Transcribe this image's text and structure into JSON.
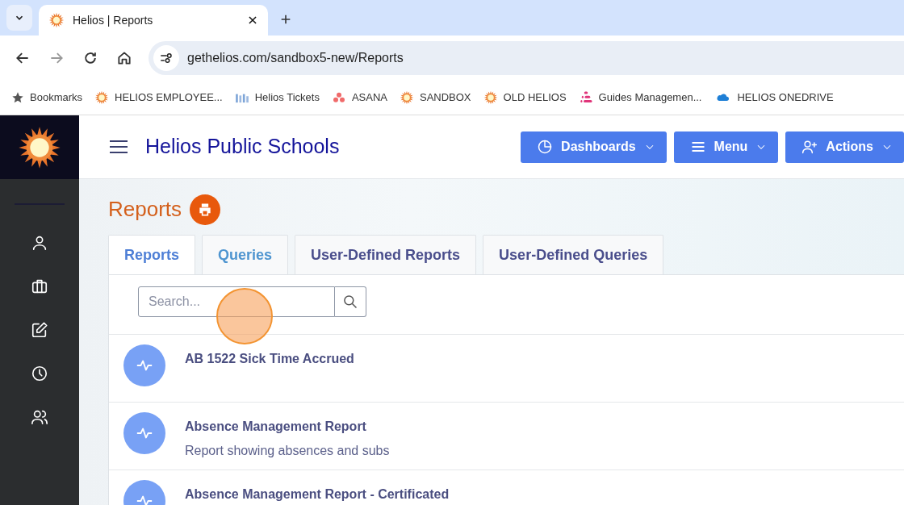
{
  "browser": {
    "tab_title": "Helios | Reports",
    "url": "gethelios.com/sandbox5-new/Reports",
    "bookmarks": [
      {
        "label": "Bookmarks"
      },
      {
        "label": "HELIOS EMPLOYEE..."
      },
      {
        "label": "Helios Tickets"
      },
      {
        "label": "ASANA"
      },
      {
        "label": "SANDBOX"
      },
      {
        "label": "OLD HELIOS"
      },
      {
        "label": "Guides Managemen..."
      },
      {
        "label": "HELIOS ONEDRIVE"
      }
    ]
  },
  "header": {
    "title": "Helios Public Schools",
    "buttons": [
      {
        "label": "Dashboards"
      },
      {
        "label": "Menu"
      },
      {
        "label": "Actions"
      }
    ]
  },
  "page": {
    "title": "Reports",
    "tabs": [
      {
        "label": "Reports",
        "selected": true
      },
      {
        "label": "Queries",
        "selected": false
      },
      {
        "label": "User-Defined Reports",
        "selected": false
      },
      {
        "label": "User-Defined Queries",
        "selected": false
      }
    ],
    "search": {
      "placeholder": "Search..."
    },
    "reports": [
      {
        "title": "AB 1522 Sick Time Accrued"
      },
      {
        "title": "Absence Management Report",
        "description": "Report showing absences and subs"
      },
      {
        "title": "Absence Management Report - Certificated"
      }
    ]
  }
}
